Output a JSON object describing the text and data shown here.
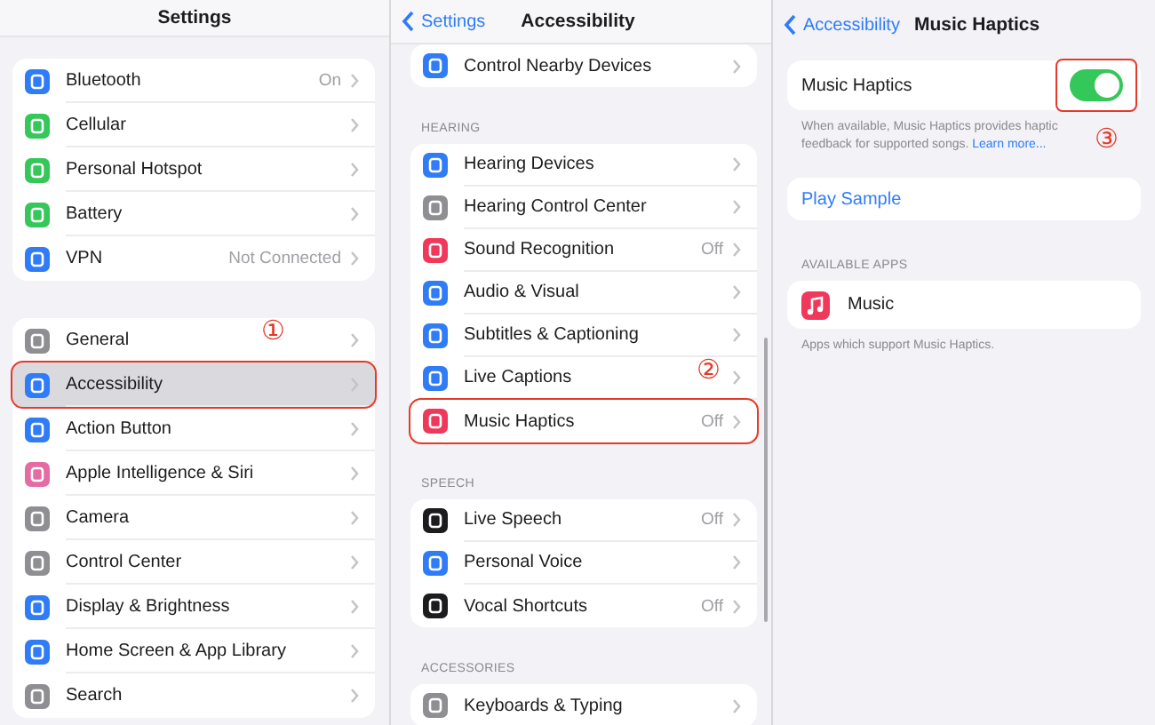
{
  "settings": {
    "title": "Settings",
    "groups": [
      {
        "items": [
          {
            "label": "Bluetooth",
            "value": "On",
            "color": "#2f7cf6",
            "selected": false,
            "outlined": false
          },
          {
            "label": "Cellular",
            "color": "#35c759",
            "selected": false,
            "outlined": false
          },
          {
            "label": "Personal Hotspot",
            "color": "#35c759",
            "selected": false,
            "outlined": false
          },
          {
            "label": "Battery",
            "color": "#35c759",
            "selected": false,
            "outlined": false
          },
          {
            "label": "VPN",
            "value": "Not Connected",
            "color": "#2f7cf6",
            "selected": false,
            "outlined": false
          }
        ]
      },
      {
        "items": [
          {
            "label": "General",
            "color": "#8e8e93",
            "selected": false,
            "outlined": false
          },
          {
            "label": "Accessibility",
            "color": "#2f7cf6",
            "selected": true,
            "outlined": true,
            "callout": "①"
          },
          {
            "label": "Action Button",
            "color": "#2f7cf6",
            "selected": false,
            "outlined": false
          },
          {
            "label": "Apple Intelligence & Siri",
            "color": "#e46ba3",
            "selected": false,
            "outlined": false
          },
          {
            "label": "Camera",
            "color": "#8e8e93",
            "selected": false,
            "outlined": false
          },
          {
            "label": "Control Center",
            "color": "#8e8e93",
            "selected": false,
            "outlined": false
          },
          {
            "label": "Display & Brightness",
            "color": "#2f7cf6",
            "selected": false,
            "outlined": false
          },
          {
            "label": "Home Screen & App Library",
            "color": "#2f7cf6",
            "selected": false,
            "outlined": false
          },
          {
            "label": "Search",
            "color": "#8e8e93",
            "selected": false,
            "outlined": false
          }
        ]
      }
    ]
  },
  "accessibility": {
    "back": "Settings",
    "title": "Accessibility",
    "sections": [
      {
        "items": [
          {
            "label": "Control Nearby Devices",
            "color": "#2f7cf6",
            "outlined": false
          }
        ]
      },
      {
        "header": "HEARING",
        "items": [
          {
            "label": "Hearing Devices",
            "color": "#2f7cf6",
            "outlined": false
          },
          {
            "label": "Hearing Control Center",
            "color": "#8e8e93",
            "outlined": false
          },
          {
            "label": "Sound Recognition",
            "value": "Off",
            "color": "#f0385a",
            "outlined": false
          },
          {
            "label": "Audio & Visual",
            "color": "#2f7cf6",
            "outlined": false
          },
          {
            "label": "Subtitles & Captioning",
            "color": "#2f7cf6",
            "outlined": false
          },
          {
            "label": "Live Captions",
            "color": "#2f7cf6",
            "outlined": false
          },
          {
            "label": "Music Haptics",
            "value": "Off",
            "color": "#f0385a",
            "outlined": true,
            "callout": "②"
          }
        ]
      },
      {
        "header": "SPEECH",
        "items": [
          {
            "label": "Live Speech",
            "value": "Off",
            "color": "#1c1c1e",
            "outlined": false
          },
          {
            "label": "Personal Voice",
            "color": "#2f7cf6",
            "outlined": false
          },
          {
            "label": "Vocal Shortcuts",
            "value": "Off",
            "color": "#1c1c1e",
            "outlined": false
          }
        ]
      },
      {
        "header": "ACCESSORIES",
        "items": [
          {
            "label": "Keyboards & Typing",
            "color": "#8e8e93",
            "outlined": false
          }
        ]
      }
    ]
  },
  "music_haptics": {
    "back": "Accessibility",
    "title": "Music Haptics",
    "toggle_row": {
      "label": "Music Haptics",
      "on": true,
      "outlined": true,
      "callout": "③"
    },
    "footer": "When available, Music Haptics provides haptic feedback for supported songs.",
    "footer_link": "Learn more...",
    "action": "Play Sample",
    "apps_header": "AVAILABLE APPS",
    "apps": [
      {
        "label": "Music",
        "color": "#f0385a"
      }
    ],
    "apps_footer": "Apps which support Music Haptics."
  }
}
